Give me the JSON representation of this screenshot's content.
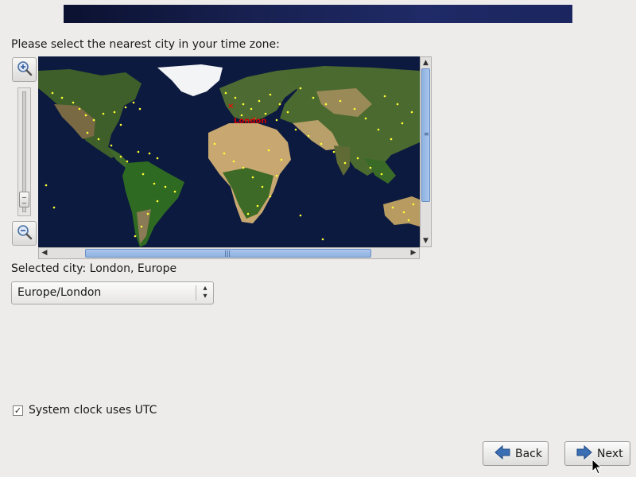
{
  "installer": {
    "prompt": "Please select the nearest city in your time zone:",
    "selected_city_label": "Selected city: London, Europe",
    "timezone_value": "Europe/London",
    "map_city_label": "London",
    "utc_label": "System clock uses UTC",
    "utc_checked": true,
    "zoom_level": 0.1
  },
  "buttons": {
    "back": "Back",
    "next": "Next"
  },
  "icons": {
    "zoom_in": "zoom-in-icon",
    "zoom_out": "zoom-out-icon",
    "back": "back-arrow-icon",
    "next": "next-arrow-icon",
    "combo": "chevron-up-down-icon"
  },
  "colors": {
    "banner": "#17204f",
    "map_ocean": "#0c1a3f",
    "city_dot": "#ffff33",
    "selected_city": "#ff0000",
    "scroll_thumb": "#9dbce8",
    "arrow_blue": "#3b6fb3"
  }
}
